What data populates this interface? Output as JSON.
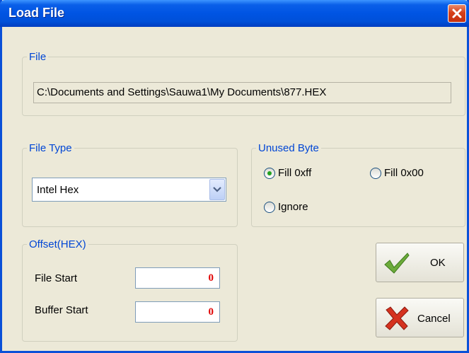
{
  "window": {
    "title": "Load File"
  },
  "file_group": {
    "legend": "File",
    "path": "C:\\Documents and Settings\\Sauwa1\\My Documents\\877.HEX"
  },
  "file_type_group": {
    "legend": "File Type",
    "selected": "Intel Hex"
  },
  "unused_byte_group": {
    "legend": "Unused Byte",
    "options": [
      {
        "label": "Fill 0xff",
        "checked": true
      },
      {
        "label": "Fill 0x00",
        "checked": false
      },
      {
        "label": "Ignore",
        "checked": false
      }
    ]
  },
  "offset_group": {
    "legend": "Offset(HEX)",
    "file_start_label": "File Start",
    "file_start_value": "0",
    "buffer_start_label": "Buffer Start",
    "buffer_start_value": "0"
  },
  "buttons": {
    "ok": {
      "label": "OK",
      "icon": "checkmark-icon"
    },
    "cancel": {
      "label": "Cancel",
      "icon": "x-cross-icon"
    }
  },
  "colors": {
    "legend_text": "#0046d5",
    "value_text": "#e00000",
    "titlebar": "#0054e3",
    "dialog_bg": "#ece9d8"
  }
}
